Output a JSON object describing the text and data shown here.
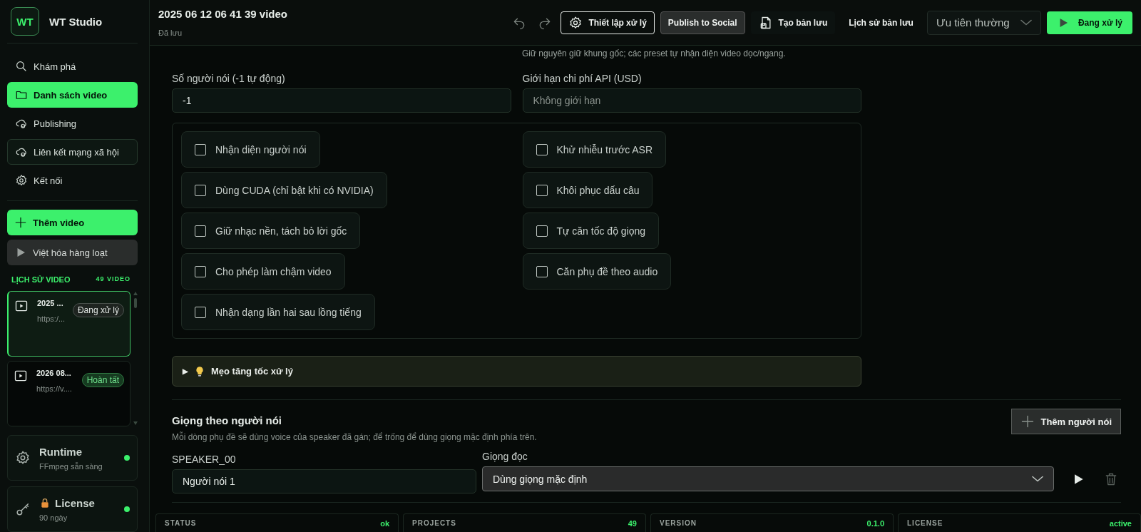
{
  "brand": {
    "logo": "WT",
    "name": "WT Studio"
  },
  "nav": [
    {
      "label": "Khám phá",
      "kind": "search",
      "selected": false,
      "highlighted": false
    },
    {
      "label": "Danh sách video",
      "kind": "folder",
      "selected": true,
      "highlighted": false
    },
    {
      "label": "Publishing",
      "kind": "cloud",
      "selected": false,
      "highlighted": false
    },
    {
      "label": "Liên kết mạng xã hội",
      "kind": "cloud",
      "selected": false,
      "highlighted": true
    },
    {
      "label": "Kết nối",
      "kind": "gear",
      "selected": false,
      "highlighted": false
    }
  ],
  "actions": [
    {
      "label": "Thêm video",
      "kind": "primary"
    },
    {
      "label": "Việt hóa hàng loạt",
      "kind": "secondary"
    }
  ],
  "history": {
    "title": "LỊCH SỬ VIDEO",
    "count": "49 VIDEO",
    "items": [
      {
        "title": "2025 ...",
        "url": "https:/...",
        "status": "Đang xử lý",
        "kind": "processing",
        "selected": true
      },
      {
        "title": "2026 08...",
        "url": "https://v....",
        "status": "Hoàn tất",
        "kind": "done",
        "selected": false
      }
    ]
  },
  "system": [
    {
      "title": "Runtime",
      "subtitle": "FFmpeg sẵn sàng",
      "kind": "runtime",
      "ok": true
    },
    {
      "title": "License",
      "subtitle": "90 ngày",
      "kind": "license",
      "ok": true
    }
  ],
  "header": {
    "title": "2025 06 12 06 41 39 video",
    "subtitle": "Đã lưu",
    "buttons": [
      {
        "label": "Thiết lập xử lý",
        "kind": "outline"
      },
      {
        "label": "Publish to Social",
        "kind": "filled"
      },
      {
        "label": "Tạo bản lưu",
        "kind": "ghost"
      },
      {
        "label": "Lịch sử bản lưu",
        "kind": "plain"
      }
    ],
    "priority": "Ưu tiên thường",
    "run_button": "Đang xử lý"
  },
  "resolution_hint": "Giữ nguyên giữ khung gốc; các preset tự nhận diện video dọc/ngang.",
  "fields": [
    {
      "label": "Số người nói (-1 tự động)",
      "value": "-1"
    },
    {
      "label": "Giới hạn chi phí API (USD)",
      "placeholder": "Không giới hạn"
    }
  ],
  "options": [
    [
      {
        "label": "Nhận diện người nói",
        "checked": false
      },
      {
        "label": "Dùng CUDA (chỉ bật khi có NVIDIA)",
        "checked": false
      },
      {
        "label": "Giữ nhạc nền, tách bỏ lời gốc",
        "checked": false
      },
      {
        "label": "Cho phép làm chậm video",
        "checked": false
      },
      {
        "label": "Nhận dạng lần hai sau lồng tiếng",
        "checked": false
      }
    ],
    [
      {
        "label": "Khử nhiễu trước ASR",
        "checked": false
      },
      {
        "label": "Khôi phục dấu câu",
        "checked": false
      },
      {
        "label": "Tự căn tốc độ giọng",
        "checked": false
      },
      {
        "label": "Căn phụ đề theo audio",
        "checked": false
      }
    ]
  ],
  "tips": {
    "arrow": "▶",
    "label": "Mẹo tăng tốc xử lý",
    "expanded": false
  },
  "speakers": {
    "title": "Giọng theo người nói",
    "description": "Mỗi dòng phụ đề sẽ dùng voice của speaker đã gán; để trống để dùng giọng mặc định phía trên.",
    "add_button": "Thêm người nói",
    "rows": [
      {
        "id_label": "SPEAKER_00",
        "name": "Người nói 1",
        "voice_label": "Giọng đọc",
        "voice": "Dùng giọng mặc định"
      }
    ]
  },
  "status_bar": [
    {
      "label": "STATUS",
      "value": "ok"
    },
    {
      "label": "PROJECTS",
      "value": "49"
    },
    {
      "label": "VERSION",
      "value": "0.1.0"
    },
    {
      "label": "LICENSE",
      "value": "active"
    }
  ]
}
